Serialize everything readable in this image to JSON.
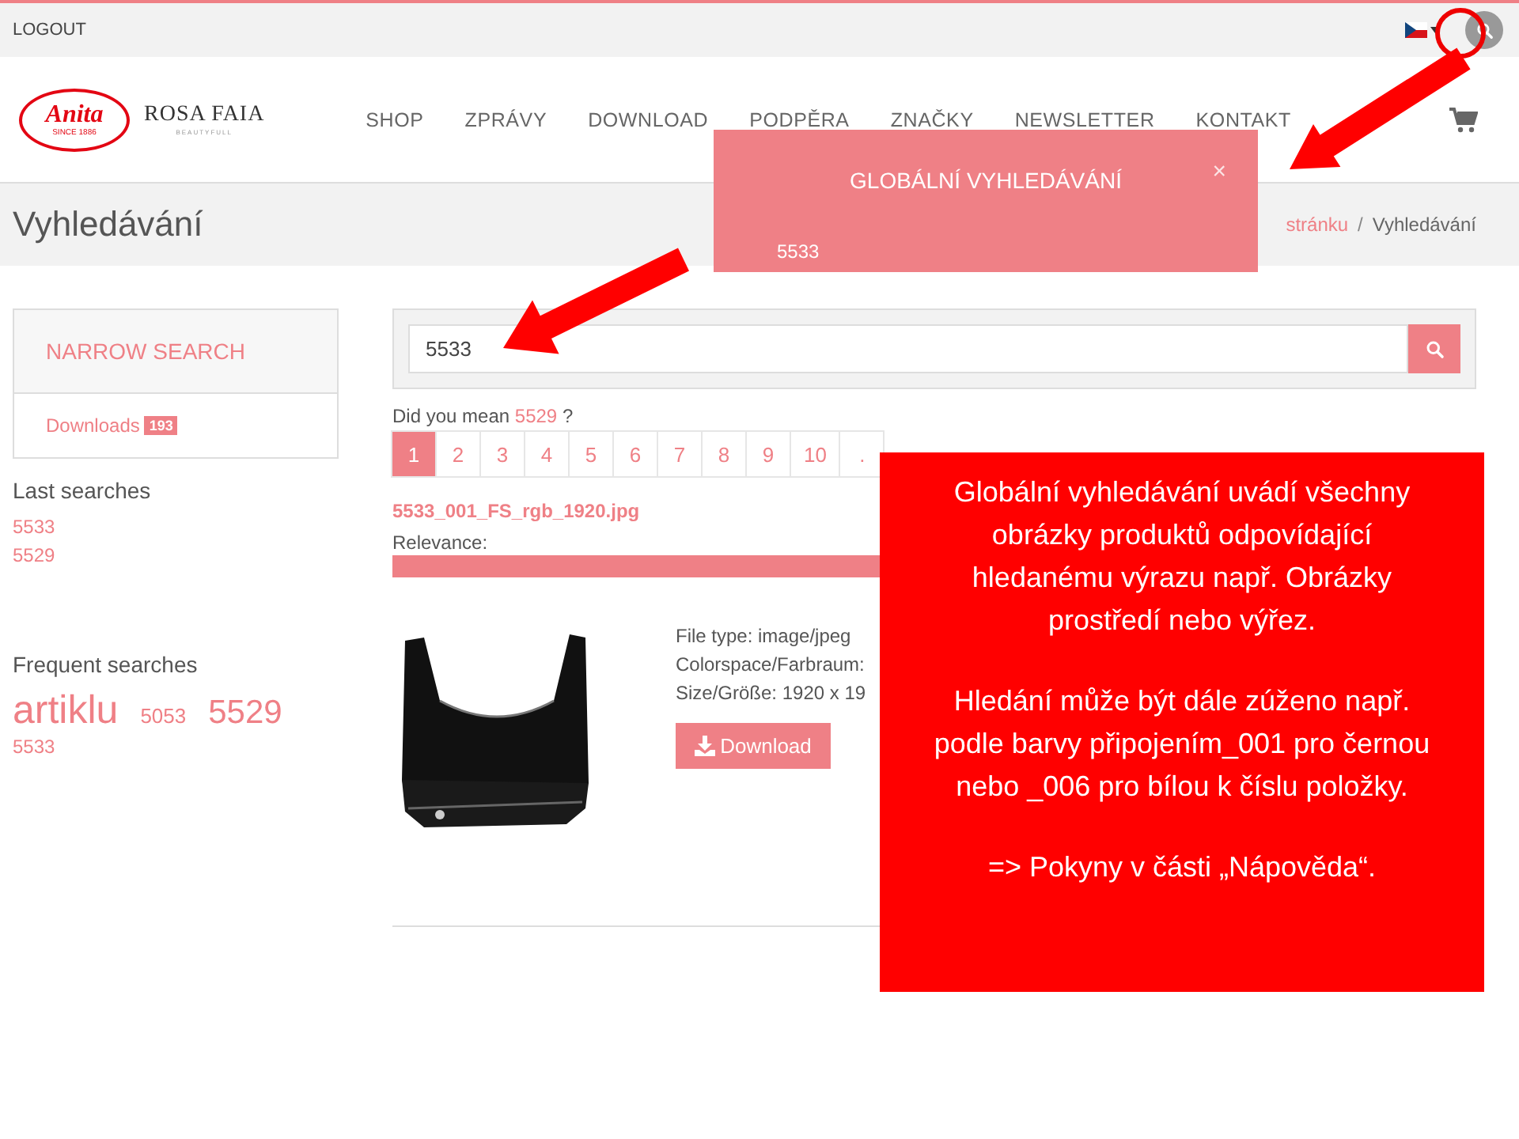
{
  "top_bar": {
    "logout": "LOGOUT"
  },
  "logo": {
    "brand": "Anita",
    "since": "SINCE 1886",
    "second_brand": "ROSA FAIA",
    "tagline": "BEAUTYFULL"
  },
  "nav": [
    "SHOP",
    "ZPRÁVY",
    "DOWNLOAD",
    "PODPĚRA",
    "ZNAČKY",
    "NEWSLETTER",
    "KONTAKT"
  ],
  "page_title": "Vyhledávání",
  "breadcrumb": {
    "items": [
      "stránku",
      "Vyhledávání"
    ],
    "separator": "/"
  },
  "sidebar": {
    "heading": "NARROW SEARCH",
    "filters": [
      {
        "label": "Downloads",
        "count": "193"
      }
    ],
    "last_searches_title": "Last searches",
    "last_searches": [
      "5533",
      "5529"
    ],
    "frequent_title": "Frequent searches",
    "frequent": [
      {
        "text": "artiklu",
        "kind": "xl"
      },
      {
        "text": "5053",
        "kind": "md"
      },
      {
        "text": "5529",
        "kind": "lg"
      },
      {
        "text": "5533",
        "kind": "sm"
      }
    ]
  },
  "search": {
    "value": "5533"
  },
  "suggestion": {
    "prefix": "Did you mean",
    "term": "5529",
    "suffix": "?"
  },
  "pagination": [
    {
      "label": "1",
      "selected": true
    },
    {
      "label": "2",
      "selected": false
    },
    {
      "label": "3",
      "selected": false
    },
    {
      "label": "4",
      "selected": false
    },
    {
      "label": "5",
      "selected": false
    },
    {
      "label": "6",
      "selected": false
    },
    {
      "label": "7",
      "selected": false
    },
    {
      "label": "8",
      "selected": false
    },
    {
      "label": "9",
      "selected": false
    },
    {
      "label": "10",
      "selected": false
    },
    {
      "label": ".",
      "selected": false
    }
  ],
  "result": {
    "filename": "5533_001_FS_rgb_1920.jpg",
    "relevance_label": "Relevance:",
    "level": 1,
    "meta": [
      "File type: image/jpeg",
      "Colorspace/Farbraum:",
      "Size/Größe: 1920 x 19"
    ],
    "download": "Download"
  },
  "popup": {
    "title": "GLOBÁLNÍ VYHLEDÁVÁNÍ",
    "close": "×",
    "value": "5533"
  },
  "annotation": {
    "paragraphs": [
      "Globální vyhledávání uvádí všechny obrázky produktů odpovídající hledanému výrazu např. Obrázky prostředí nebo výřez.",
      "Hledání může být dále zúženo např. podle barvy připojením_001 pro černou nebo _006 pro bílou k číslu položky.",
      "=> Pokyny v části „Nápověda“."
    ]
  }
}
